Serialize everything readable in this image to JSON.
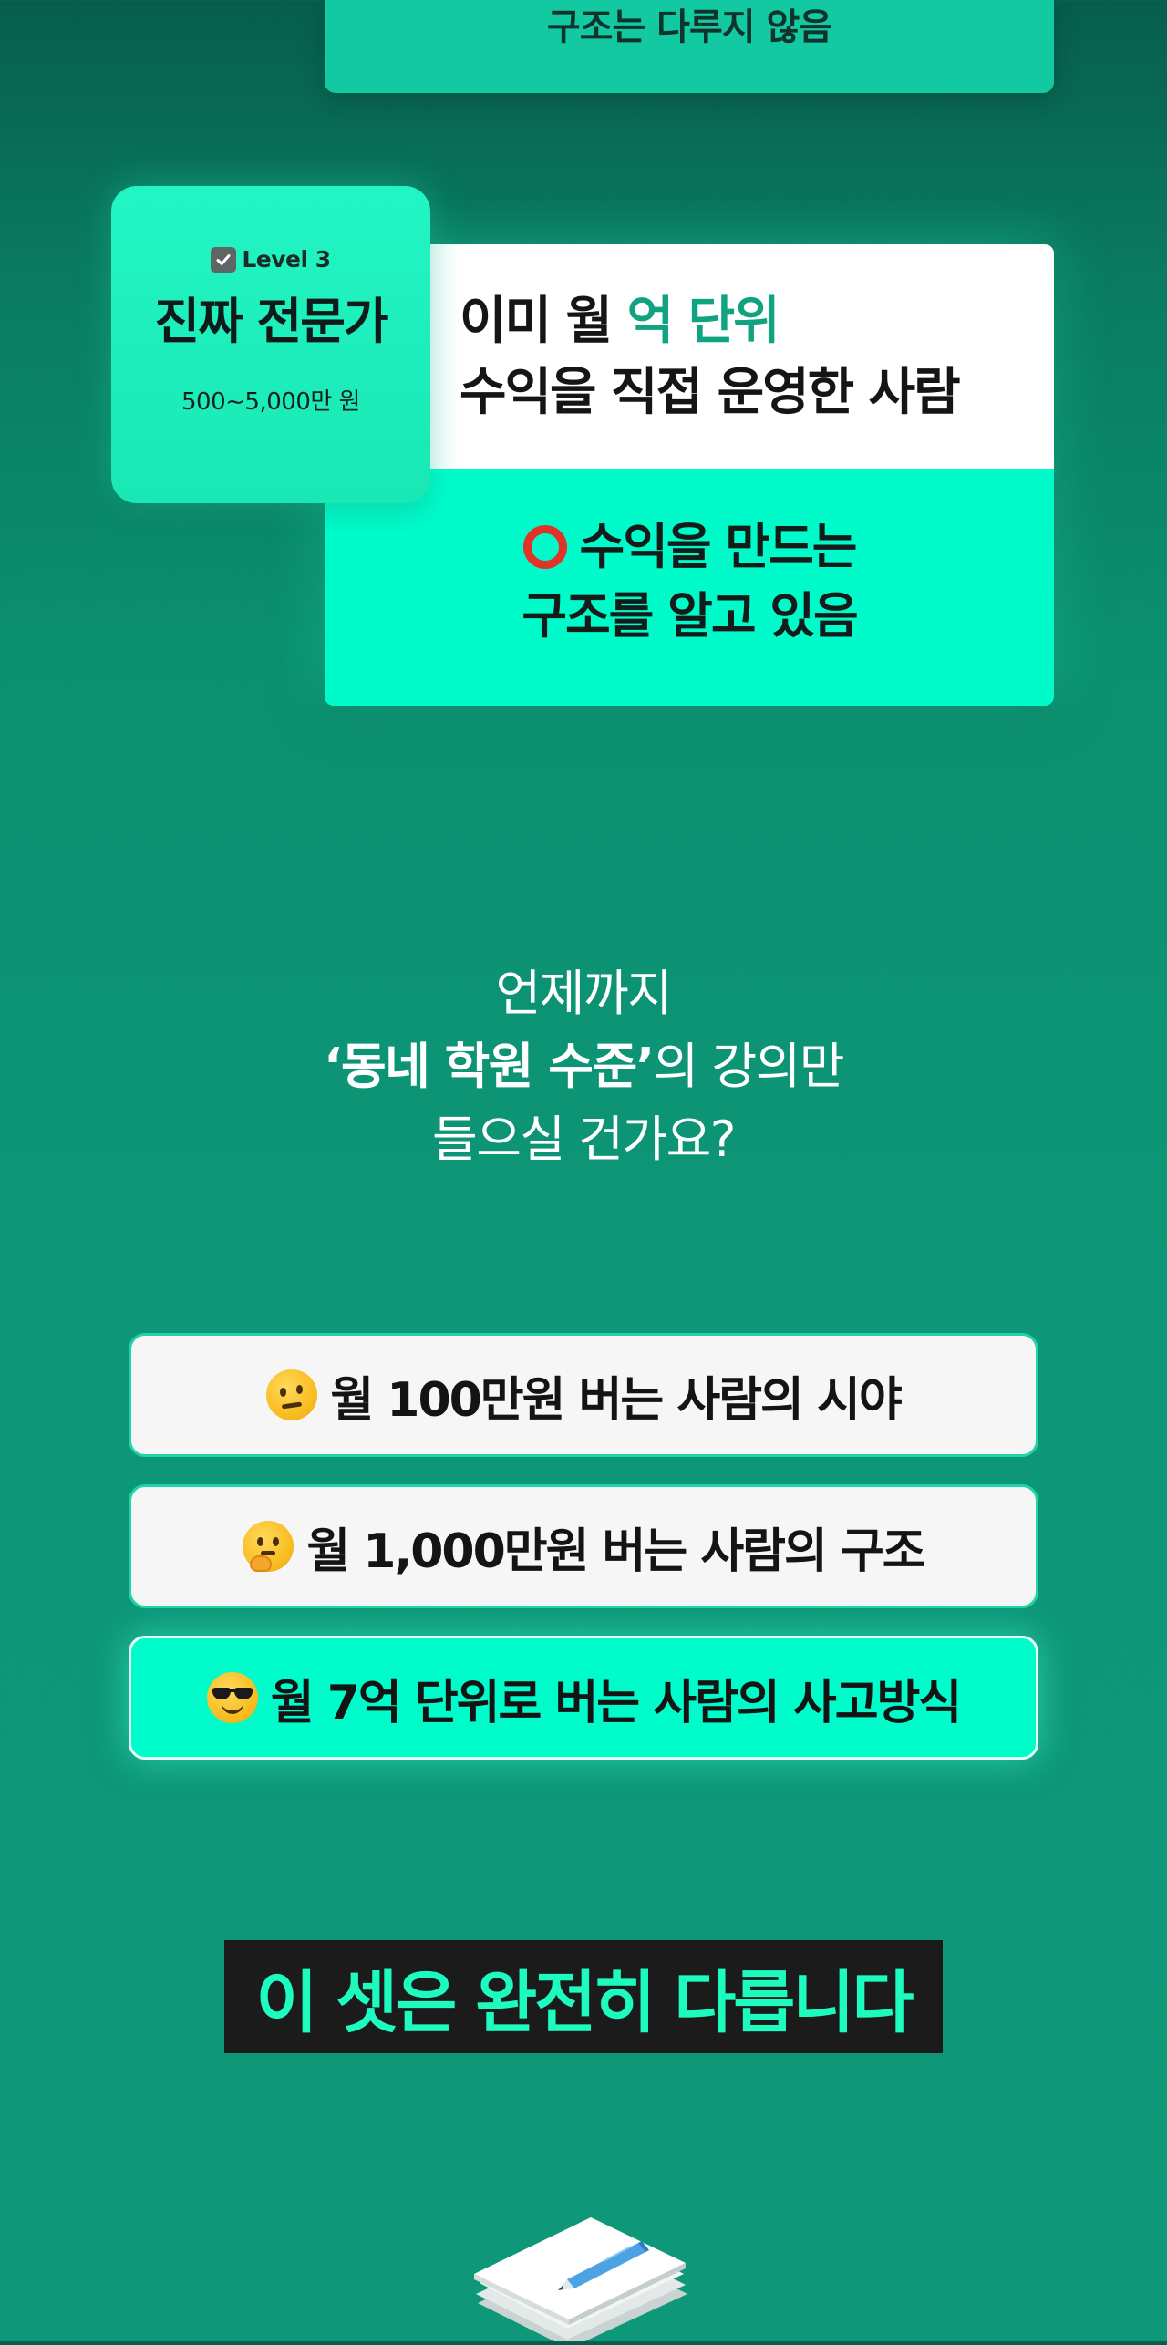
{
  "top_card": {
    "text": "구조는 다루지 않음"
  },
  "level3": {
    "badge_label": "Level 3",
    "title": "진짜 전문가",
    "price": "500~5,000만 원",
    "desc_line1_prefix": "이미 월 ",
    "desc_line1_accent": "억 단위",
    "desc_line2": "수익을 직접 운영한 사람",
    "result_line1": "수익을 만드는",
    "result_line2": "구조를 알고 있음",
    "result_icon": "red-circle-icon"
  },
  "question": {
    "line1": "언제까지",
    "line2_bold": "‘동네 학원 수준’",
    "line2_rest": "의 강의만",
    "line3": "들으실 건가요?"
  },
  "options": [
    {
      "icon": "raised-eyebrow-face-icon",
      "label": "월 100만원 버는 사람의 시야"
    },
    {
      "icon": "thinking-face-icon",
      "label": "월 1,000만원 버는 사람의 구조"
    },
    {
      "icon": "sunglasses-face-icon",
      "label": "월 7억 단위로 버는 사람의 사고방식"
    }
  ],
  "banner": {
    "text": "이 셋은 완전히 다릅니다"
  },
  "colors": {
    "background": "#0e9879",
    "accent_mint": "#00fbcb",
    "accent_green_text": "#10a37f",
    "banner_text": "#1dfbbf",
    "banner_bg": "#1b1b1b"
  }
}
